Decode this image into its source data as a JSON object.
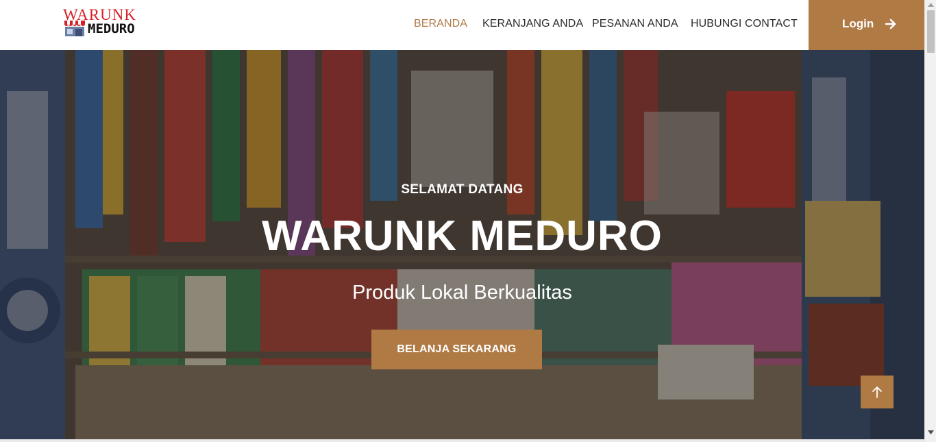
{
  "logo": {
    "line1": "WARUNK",
    "line2": "MEDURO"
  },
  "nav": {
    "items": [
      {
        "label": "BERANDA",
        "active": true
      },
      {
        "label": "KERANJANG ANDA",
        "active": false
      },
      {
        "label": "PESANAN ANDA",
        "active": false
      },
      {
        "label": "HUBUNGI CONTACT",
        "active": false
      }
    ],
    "login_label": "Login",
    "login_icon": "arrow-right-icon"
  },
  "hero": {
    "eyebrow": "SELAMAT DATANG",
    "title": "WARUNK MEDURO",
    "subtitle": "Produk Lokal Berkualitas",
    "cta_label": "BELANJA SEKARANG"
  },
  "back_to_top_icon": "arrow-up-icon",
  "colors": {
    "accent": "#b07a45",
    "logo_red": "#d61f26",
    "nav_text": "#2b2b2b"
  }
}
